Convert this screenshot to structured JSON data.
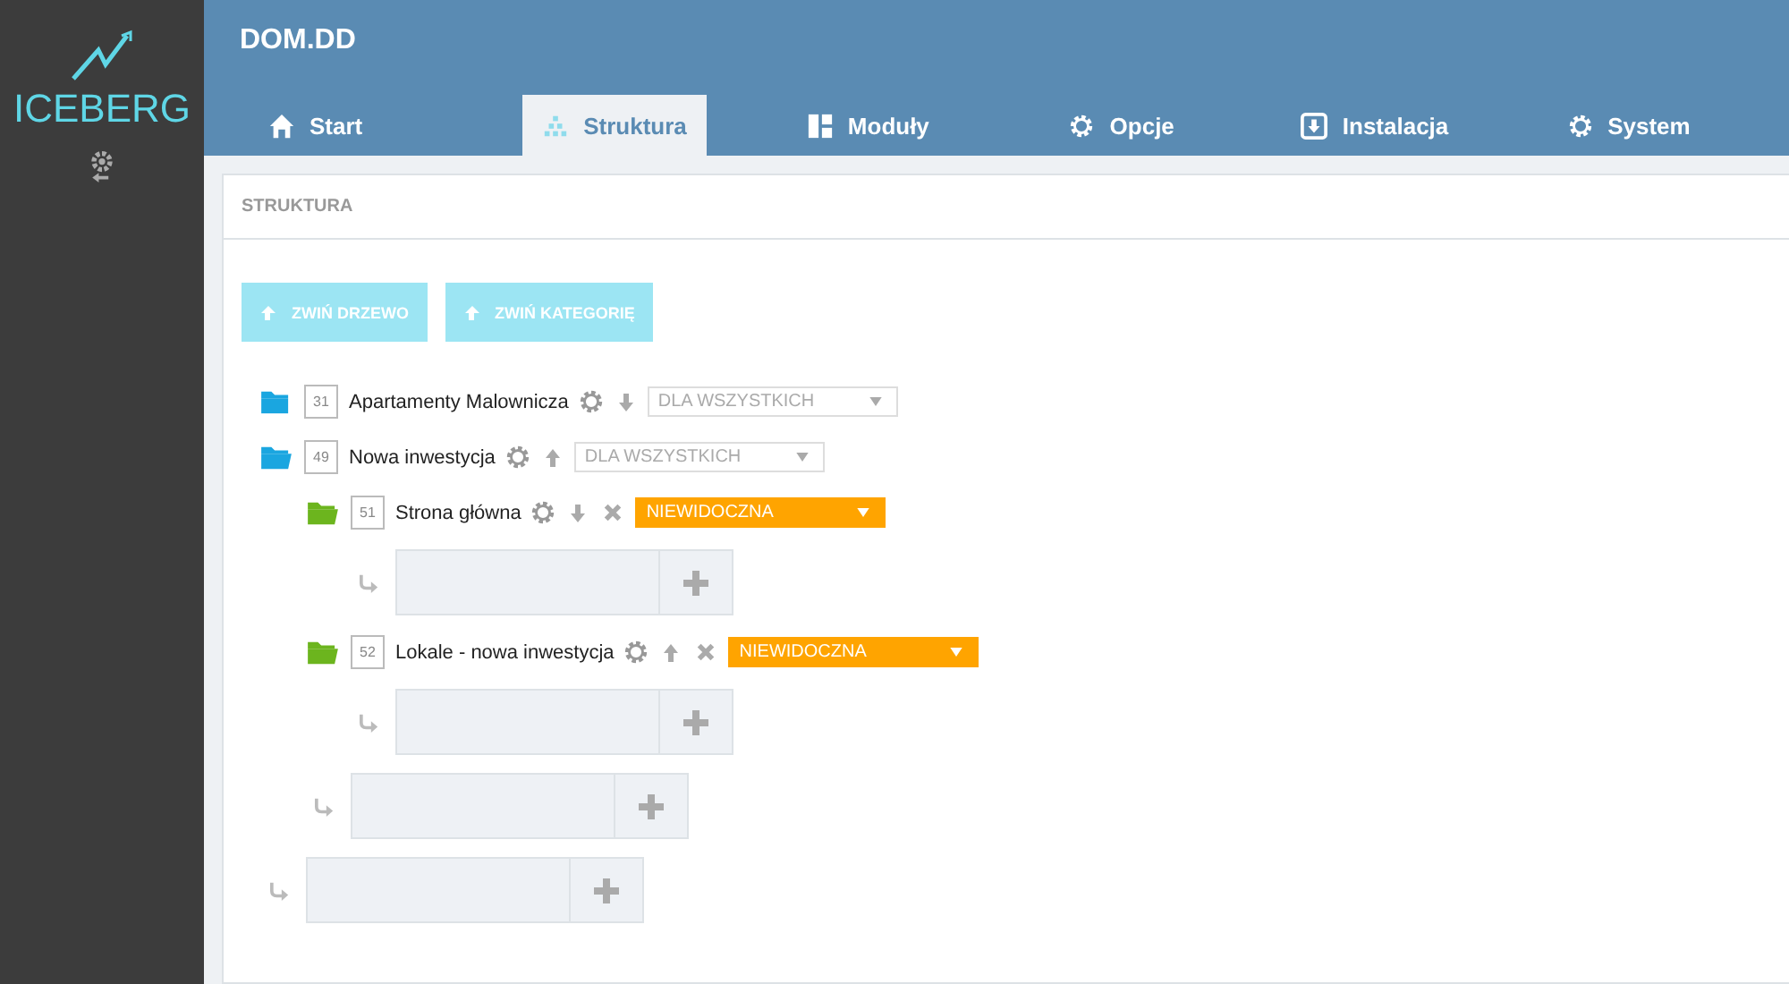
{
  "sidebar": {
    "logo": "ICEBERG"
  },
  "header": {
    "title": "DOM.DD"
  },
  "tabs": [
    {
      "label": "Start",
      "kind": "home",
      "selected": false
    },
    {
      "label": "Struktura",
      "kind": "tree",
      "selected": true
    },
    {
      "label": "Moduły",
      "kind": "modules",
      "selected": false
    },
    {
      "label": "Opcje",
      "kind": "gear",
      "selected": false
    },
    {
      "label": "Instalacja",
      "kind": "install",
      "selected": false
    },
    {
      "label": "System",
      "kind": "gear",
      "selected": false
    }
  ],
  "panel": {
    "title": "STRUKTURA"
  },
  "buttons": [
    {
      "label": "ZWIŃ DRZEWO"
    },
    {
      "label": "ZWIŃ KATEGORIĘ"
    }
  ],
  "tree": [
    {
      "id": "31",
      "name": "Apartamenty Malownicza",
      "color": "#1aa6e0",
      "moves_up": false,
      "deletable": false,
      "expanded": false,
      "visibility": {
        "label": "DLA WSZYSTKICH",
        "warning": false
      }
    },
    {
      "id": "49",
      "name": "Nowa inwestycja",
      "color": "#1aa6e0",
      "moves_up": true,
      "deletable": false,
      "expanded": true,
      "visibility": {
        "label": "DLA WSZYSTKICH",
        "warning": false
      },
      "children": [
        {
          "id": "51",
          "name": "Strona główna",
          "color": "#6cb51e",
          "moves_up": false,
          "deletable": true,
          "expanded": true,
          "visibility": {
            "label": "NIEWIDOCZNA",
            "warning": true
          }
        },
        {
          "id": "52",
          "name": "Lokale - nowa inwestycja",
          "color": "#6cb51e",
          "moves_up": true,
          "deletable": true,
          "expanded": true,
          "visibility": {
            "label": "NIEWIDOCZNA",
            "warning": true
          }
        }
      ]
    }
  ]
}
